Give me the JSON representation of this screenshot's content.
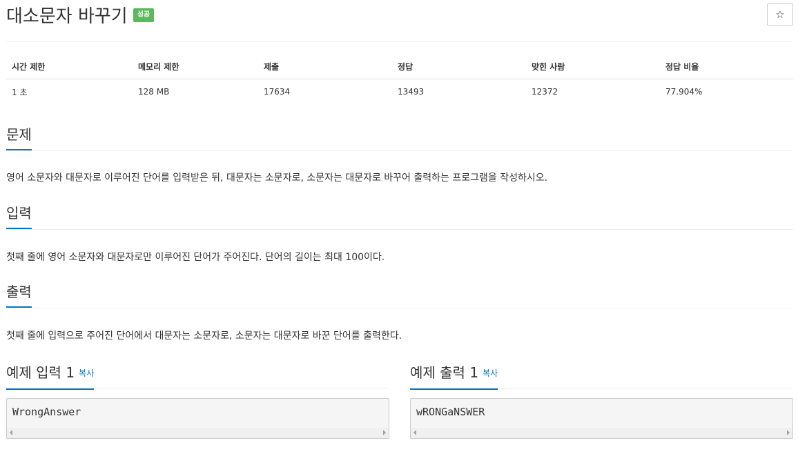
{
  "problem": {
    "title": "대소문자 바꾸기",
    "status_badge": "성공",
    "star_icon": "☆"
  },
  "info_table": {
    "headers": [
      "시간 제한",
      "메모리 제한",
      "제출",
      "정답",
      "맞힌 사람",
      "정답 비율"
    ],
    "values": [
      "1 초",
      "128 MB",
      "17634",
      "13493",
      "12372",
      "77.904%"
    ]
  },
  "sections": {
    "description": {
      "title": "문제",
      "text": "영어 소문자와 대문자로 이루어진 단어를 입력받은 뒤, 대문자는 소문자로, 소문자는 대문자로 바꾸어 출력하는 프로그램을 작성하시오."
    },
    "input": {
      "title": "입력",
      "text": "첫째 줄에 영어 소문자와 대문자로만 이루어진 단어가 주어진다. 단어의 길이는 최대 100이다."
    },
    "output": {
      "title": "출력",
      "text": "첫째 줄에 입력으로 주어진 단어에서 대문자는 소문자로, 소문자는 대문자로 바꾼 단어를 출력한다."
    }
  },
  "samples": {
    "input": {
      "title": "예제 입력 1",
      "copy_label": "복사",
      "content": "WrongAnswer"
    },
    "output": {
      "title": "예제 출력 1",
      "copy_label": "복사",
      "content": "wRONGaNSWER"
    }
  },
  "colors": {
    "accent": "#0076c0",
    "success_badge": "#5cb85c"
  }
}
